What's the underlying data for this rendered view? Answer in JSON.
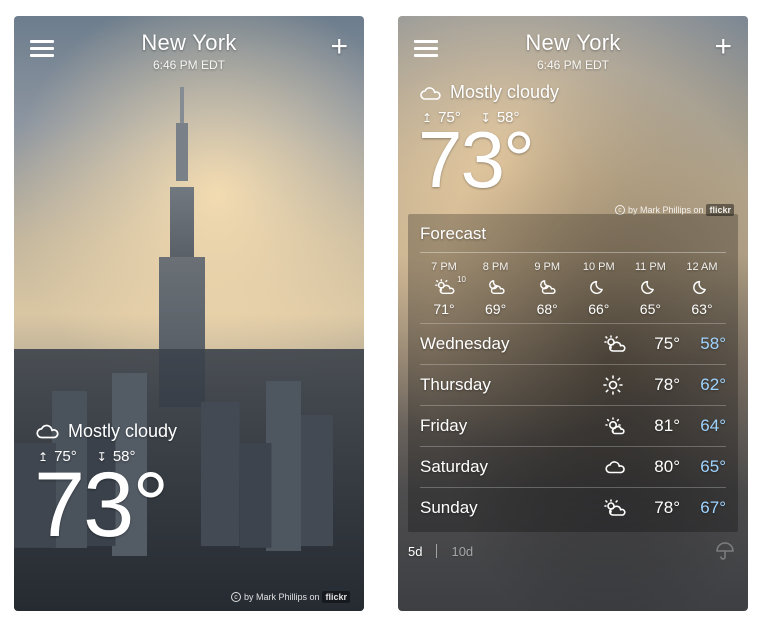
{
  "left": {
    "city": "New York",
    "time": "6:46 PM EDT",
    "condition": "Mostly cloudy",
    "high": "75°",
    "low": "58°",
    "temp": "73°",
    "attr_prefix": "by Mark Phillips on",
    "attr_brand": "flickr"
  },
  "right": {
    "city": "New York",
    "time": "6:46 PM EDT",
    "condition": "Mostly cloudy",
    "high": "75°",
    "low": "58°",
    "temp": "73°",
    "attr_prefix": "by Mark Phillips on",
    "attr_brand": "flickr",
    "forecast_title": "Forecast",
    "hours": [
      {
        "t": "7 PM",
        "icon": "partly-cloudy",
        "pop": "10",
        "deg": "71°"
      },
      {
        "t": "8 PM",
        "icon": "cloudy-night",
        "pop": "",
        "deg": "69°"
      },
      {
        "t": "9 PM",
        "icon": "cloudy-night",
        "pop": "",
        "deg": "68°"
      },
      {
        "t": "10 PM",
        "icon": "moon",
        "pop": "",
        "deg": "66°"
      },
      {
        "t": "11 PM",
        "icon": "moon",
        "pop": "",
        "deg": "65°"
      },
      {
        "t": "12 AM",
        "icon": "moon",
        "pop": "",
        "deg": "63°"
      }
    ],
    "days": [
      {
        "name": "Wednesday",
        "icon": "partly-cloudy",
        "hi": "75°",
        "lo": "58°"
      },
      {
        "name": "Thursday",
        "icon": "sunny",
        "hi": "78°",
        "lo": "62°"
      },
      {
        "name": "Friday",
        "icon": "mostly-sunny",
        "hi": "81°",
        "lo": "64°"
      },
      {
        "name": "Saturday",
        "icon": "cloudy",
        "hi": "80°",
        "lo": "65°"
      },
      {
        "name": "Sunday",
        "icon": "partly-cloudy",
        "hi": "78°",
        "lo": "67°"
      }
    ],
    "range": {
      "5d": "5d",
      "10d": "10d"
    }
  }
}
